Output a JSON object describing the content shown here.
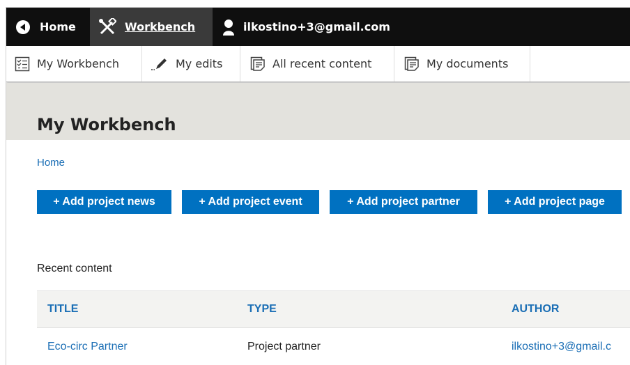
{
  "toolbar": {
    "home_label": "Home",
    "workbench_label": "Workbench",
    "user_label": "ilkostino+3@gmail.com"
  },
  "tray": {
    "items": [
      {
        "label": "My Workbench",
        "icon": "checklist-icon"
      },
      {
        "label": "My edits",
        "icon": "pencil-icon"
      },
      {
        "label": "All recent content",
        "icon": "document-icon"
      },
      {
        "label": "My documents",
        "icon": "document-icon"
      }
    ]
  },
  "page": {
    "title": "My Workbench",
    "breadcrumb": "Home"
  },
  "actions": [
    {
      "label": "+ Add project news"
    },
    {
      "label": "+ Add project event"
    },
    {
      "label": "+ Add project partner"
    },
    {
      "label": "+ Add project page"
    }
  ],
  "recent": {
    "heading": "Recent content",
    "columns": {
      "title": "TITLE",
      "type": "TYPE",
      "author": "AUTHOR"
    },
    "rows": [
      {
        "title": "Eco-circ Partner",
        "type": "Project partner",
        "author": "ilkostino+3@gmail.c"
      }
    ]
  },
  "colors": {
    "toolbar_bg": "#0f0f0f",
    "accent": "#0071c1",
    "link": "#1a6eb5",
    "header_band": "#e3e2dd"
  }
}
